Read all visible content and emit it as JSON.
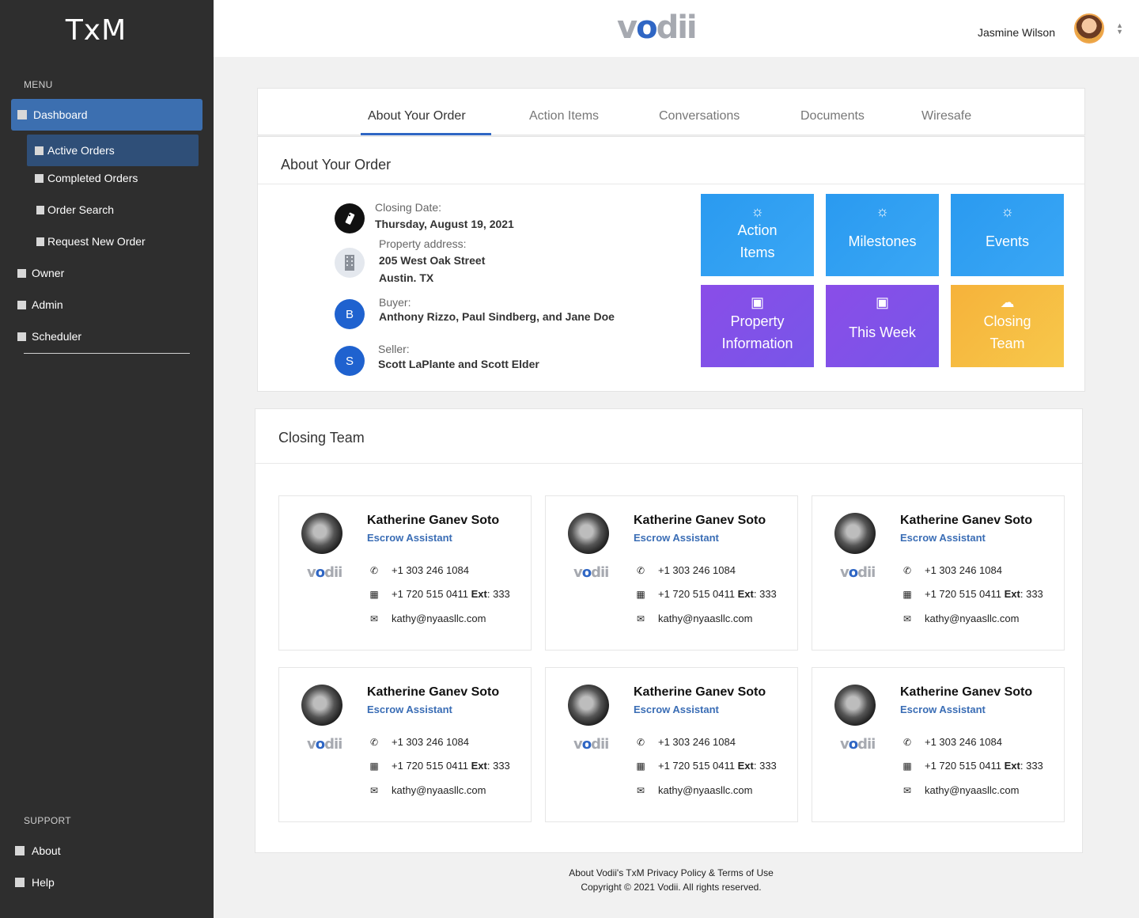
{
  "sidebar": {
    "brand": "TxM",
    "menu_label": "MENU",
    "items": [
      {
        "label": "Dashboard"
      },
      {
        "label": "Active Orders"
      },
      {
        "label": "Completed Orders"
      },
      {
        "label": "Order Search"
      },
      {
        "label": "Request New Order"
      },
      {
        "label": "Owner"
      },
      {
        "label": "Admin"
      },
      {
        "label": "Scheduler"
      }
    ],
    "support_label": "SUPPORT",
    "support_items": [
      {
        "label": "About"
      },
      {
        "label": "Help"
      }
    ]
  },
  "header": {
    "logo": {
      "v": "v",
      "o": "o",
      "rest": "dii"
    },
    "user_name": "Jasmine Wilson"
  },
  "tabs": [
    {
      "label": "About Your Order",
      "active": true
    },
    {
      "label": "Action Items"
    },
    {
      "label": "Conversations"
    },
    {
      "label": "Documents"
    },
    {
      "label": "Wiresafe"
    }
  ],
  "order": {
    "title": "About Your Order",
    "closing_date_label": "Closing Date:",
    "closing_date": "Thursday, August 19, 2021",
    "property_label": "Property address:",
    "property_line1": "205 West Oak Street",
    "property_line2": "Austin. TX",
    "buyer_label": "Buyer:",
    "buyer_initial": "B",
    "buyer": "Anthony Rizzo, Paul Sindberg, and Jane Doe",
    "seller_label": "Seller:",
    "seller_initial": "S",
    "seller": "Scott LaPlante and Scott Elder"
  },
  "tiles": [
    {
      "line1": "Action",
      "line2": "Items"
    },
    {
      "line1": "Milestones",
      "line2": ""
    },
    {
      "line1": "Events",
      "line2": ""
    },
    {
      "line1": "Property",
      "line2": "Information"
    },
    {
      "line1": "This Week",
      "line2": ""
    },
    {
      "line1": "Closing",
      "line2": "Team"
    }
  ],
  "team": {
    "title": "Closing Team",
    "members": [
      {
        "name": "Katherine Ganev Soto",
        "role": "Escrow Assistant",
        "phone": "+1 303 246 1084",
        "office": "+1 720 515 0411",
        "ext_label": "Ext",
        "ext": ": 333",
        "email": "kathy@nyaasllc.com"
      },
      {
        "name": "Katherine Ganev Soto",
        "role": "Escrow Assistant",
        "phone": "+1 303 246 1084",
        "office": "+1 720 515 0411",
        "ext_label": "Ext",
        "ext": ": 333",
        "email": "kathy@nyaasllc.com"
      },
      {
        "name": "Katherine Ganev Soto",
        "role": "Escrow Assistant",
        "phone": "+1 303 246 1084",
        "office": "+1 720 515 0411",
        "ext_label": "Ext",
        "ext": ": 333",
        "email": "kathy@nyaasllc.com"
      },
      {
        "name": "Katherine Ganev Soto",
        "role": "Escrow Assistant",
        "phone": "+1 303 246 1084",
        "office": "+1 720 515 0411",
        "ext_label": "Ext",
        "ext": ": 333",
        "email": "kathy@nyaasllc.com"
      },
      {
        "name": "Katherine Ganev Soto",
        "role": "Escrow Assistant",
        "phone": "+1 303 246 1084",
        "office": "+1 720 515 0411",
        "ext_label": "Ext",
        "ext": ": 333",
        "email": "kathy@nyaasllc.com"
      },
      {
        "name": "Katherine Ganev Soto",
        "role": "Escrow Assistant",
        "phone": "+1 303 246 1084",
        "office": "+1 720 515 0411",
        "ext_label": "Ext",
        "ext": ": 333",
        "email": "kathy@nyaasllc.com"
      }
    ]
  },
  "footer": {
    "links": "About Vodii's TxM Privacy Policy & Terms of Use",
    "copyright": "Copyright © 2021 Vodii. All rights reserved."
  },
  "colors": {
    "sidebar_bg": "#2e2e2e",
    "active_nav": "#3c6fb0",
    "accent": "#2f66c4",
    "tile_blue": "#2a9af0",
    "tile_purple": "#8a4de8",
    "tile_yellow": "#f6b23a"
  },
  "icons": {
    "closing_date": "tag-icon",
    "property": "building-icon",
    "tile_top": [
      "sunrise-icon",
      "sunrise-icon",
      "sunrise-icon",
      "calendar-icon",
      "calendar-icon",
      "cloud-icon"
    ],
    "phone": "phone-icon",
    "office": "fax-icon",
    "email": "mail-icon"
  }
}
